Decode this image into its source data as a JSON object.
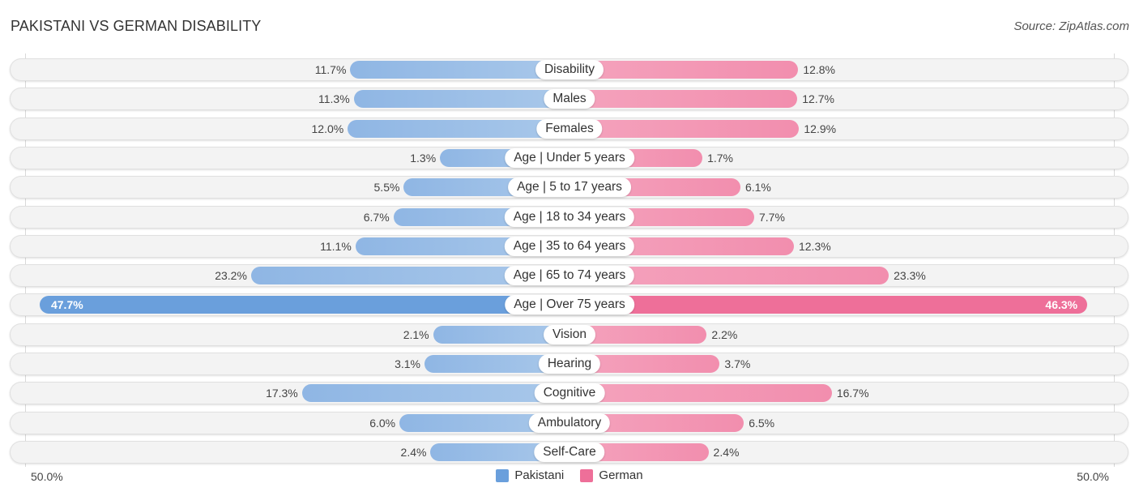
{
  "header": {
    "title": "PAKISTANI VS GERMAN DISABILITY",
    "source": "Source: ZipAtlas.com"
  },
  "colors": {
    "pakistani": "#6a9fdc",
    "german": "#ee6f99"
  },
  "chart_data": {
    "type": "bar",
    "orientation": "horizontal-diverging",
    "title": "PAKISTANI VS GERMAN DISABILITY",
    "xlabel": "",
    "ylabel": "",
    "axis_range": [
      -50.0,
      50.0
    ],
    "axis_tick_labels": {
      "left": "50.0%",
      "right": "50.0%"
    },
    "legend": {
      "placement": "bottom-center",
      "entries": [
        "Pakistani",
        "German"
      ]
    },
    "categories": [
      "Disability",
      "Males",
      "Females",
      "Age | Under 5 years",
      "Age | 5 to 17 years",
      "Age | 18 to 34 years",
      "Age | 35 to 64 years",
      "Age | 65 to 74 years",
      "Age | Over 75 years",
      "Vision",
      "Hearing",
      "Cognitive",
      "Ambulatory",
      "Self-Care"
    ],
    "series": [
      {
        "name": "Pakistani",
        "side": "left",
        "values": [
          11.7,
          11.3,
          12.0,
          1.3,
          5.5,
          6.7,
          11.1,
          23.2,
          47.7,
          2.1,
          3.1,
          17.3,
          6.0,
          2.4
        ],
        "labels": [
          "11.7%",
          "11.3%",
          "12.0%",
          "1.3%",
          "5.5%",
          "6.7%",
          "11.1%",
          "23.2%",
          "47.7%",
          "2.1%",
          "3.1%",
          "17.3%",
          "6.0%",
          "2.4%"
        ]
      },
      {
        "name": "German",
        "side": "right",
        "values": [
          12.8,
          12.7,
          12.9,
          1.7,
          6.1,
          7.7,
          12.3,
          23.3,
          46.3,
          2.2,
          3.7,
          16.7,
          6.5,
          2.4
        ],
        "labels": [
          "12.8%",
          "12.7%",
          "12.9%",
          "1.7%",
          "6.1%",
          "7.7%",
          "12.3%",
          "23.3%",
          "46.3%",
          "2.2%",
          "3.7%",
          "16.7%",
          "6.5%",
          "2.4%"
        ]
      }
    ]
  }
}
